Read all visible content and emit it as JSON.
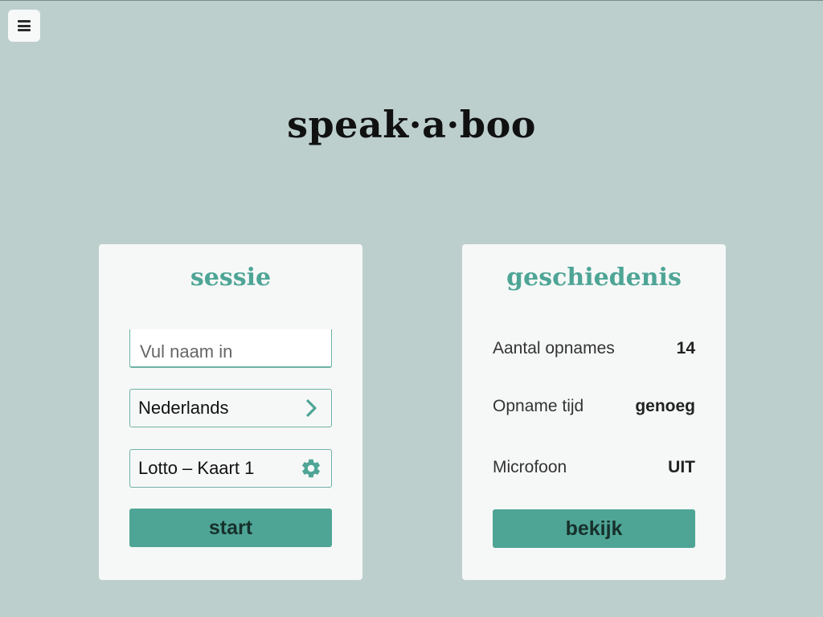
{
  "app": {
    "logo": "speak·a·boo"
  },
  "menu": {
    "icon": "hamburger-menu-icon"
  },
  "sessie": {
    "title": "sessie",
    "name_input": {
      "value": "",
      "placeholder": "Vul naam in"
    },
    "language": {
      "label": "Nederlands",
      "icon": "chevron-right-icon"
    },
    "game": {
      "label": "Lotto – Kaart 1",
      "icon": "gear-icon"
    },
    "start_label": "start"
  },
  "geschiedenis": {
    "title": "geschiedenis",
    "stats": [
      {
        "label": "Aantal opnames",
        "value": "14"
      },
      {
        "label": "Opname tijd",
        "value": "genoeg"
      },
      {
        "label": "Microfoon",
        "value": "UIT"
      }
    ],
    "view_label": "bekijk"
  },
  "colors": {
    "background": "#bccfcd",
    "card": "#f6f8f7",
    "accent": "#4ea596",
    "text_dark": "#111111"
  }
}
